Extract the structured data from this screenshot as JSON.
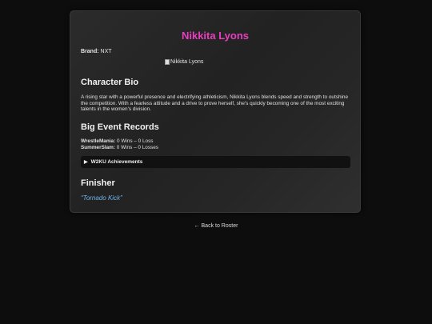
{
  "profile": {
    "name": "Nikkita Lyons",
    "brand_label": "Brand:",
    "brand_value": "NXT",
    "image_alt": "Nikkita Lyons"
  },
  "bio": {
    "heading": "Character Bio",
    "text": "A rising star with a powerful presence and electrifying athleticism, Nikkita Lyons blends speed and strength to outshine the competition. With a fearless attitude and a drive to prove herself, she's quickly becoming one of the most exciting talents in the women's division."
  },
  "records": {
    "heading": "Big Event Records",
    "items": [
      {
        "event": "WrestleMania:",
        "value": "0 Wins – 0 Loss"
      },
      {
        "event": "SummerSlam:",
        "value": "0 Wins – 0 Losses"
      }
    ],
    "achievements_label": "W2KU Achievements"
  },
  "finisher": {
    "heading": "Finisher",
    "move": "“Tornado Kick”"
  },
  "nav": {
    "back_label": "← Back to Roster"
  },
  "colors": {
    "name_accent": "#e83fbf",
    "finisher_text": "#6fb3e8",
    "background": "#0d0d0d",
    "card": "#262626"
  }
}
